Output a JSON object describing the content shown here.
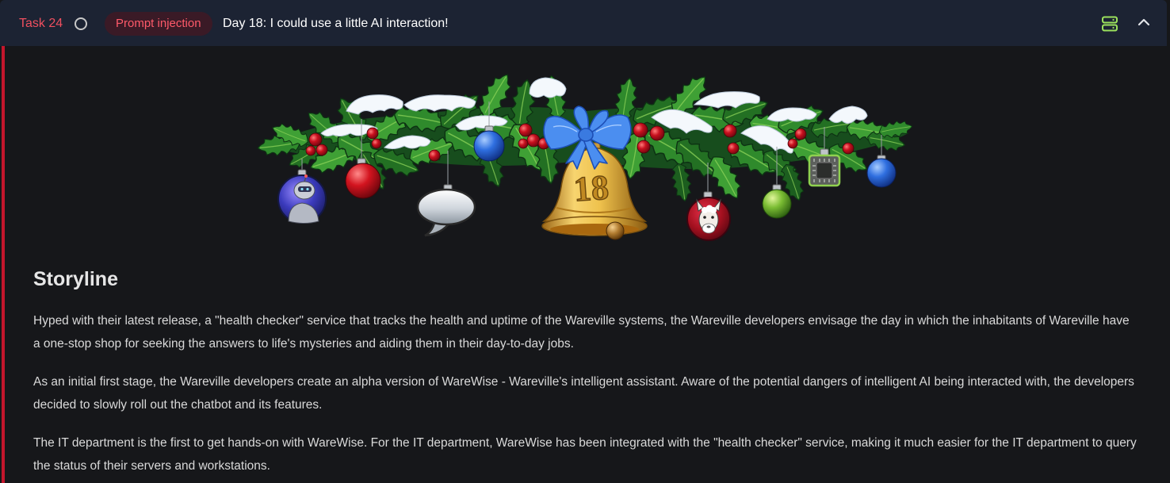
{
  "task": {
    "label": "Task 24",
    "status_icon": "circle-outline-icon",
    "tag": "Prompt injection",
    "title": "Day 18: I could use a little AI interaction!",
    "actions": {
      "server_icon": "server-icon",
      "collapse_icon": "chevron-up-icon"
    }
  },
  "banner": {
    "bell_number": "18"
  },
  "storyline": {
    "heading": "Storyline",
    "paragraphs": [
      "Hyped with their latest release, a \"health checker\" service that tracks the health and uptime of the Wareville systems, the Wareville developers envisage the day in which the inhabitants of Wareville have a one-stop shop for seeking the answers to life's mysteries and aiding them in their day-to-day jobs.",
      "As an initial first stage, the Wareville developers create an alpha version of WareWise - Wareville's intelligent assistant. Aware of the potential dangers of intelligent AI being interacted with, the developers decided to slowly roll out the chatbot and its features.",
      "The IT department is the first to get hands-on with WareWise. For the IT department, WareWise has been integrated with the \"health checker\" service, making it much easier for the IT department to query the status of their servers and workstations."
    ]
  },
  "colors": {
    "accent_red": "#ef4f5f",
    "tag_bg": "#3a1a26",
    "header_bg": "#1c2333",
    "page_bg": "#16171a",
    "left_border": "#c4162c",
    "server_icon": "#9be15d"
  }
}
